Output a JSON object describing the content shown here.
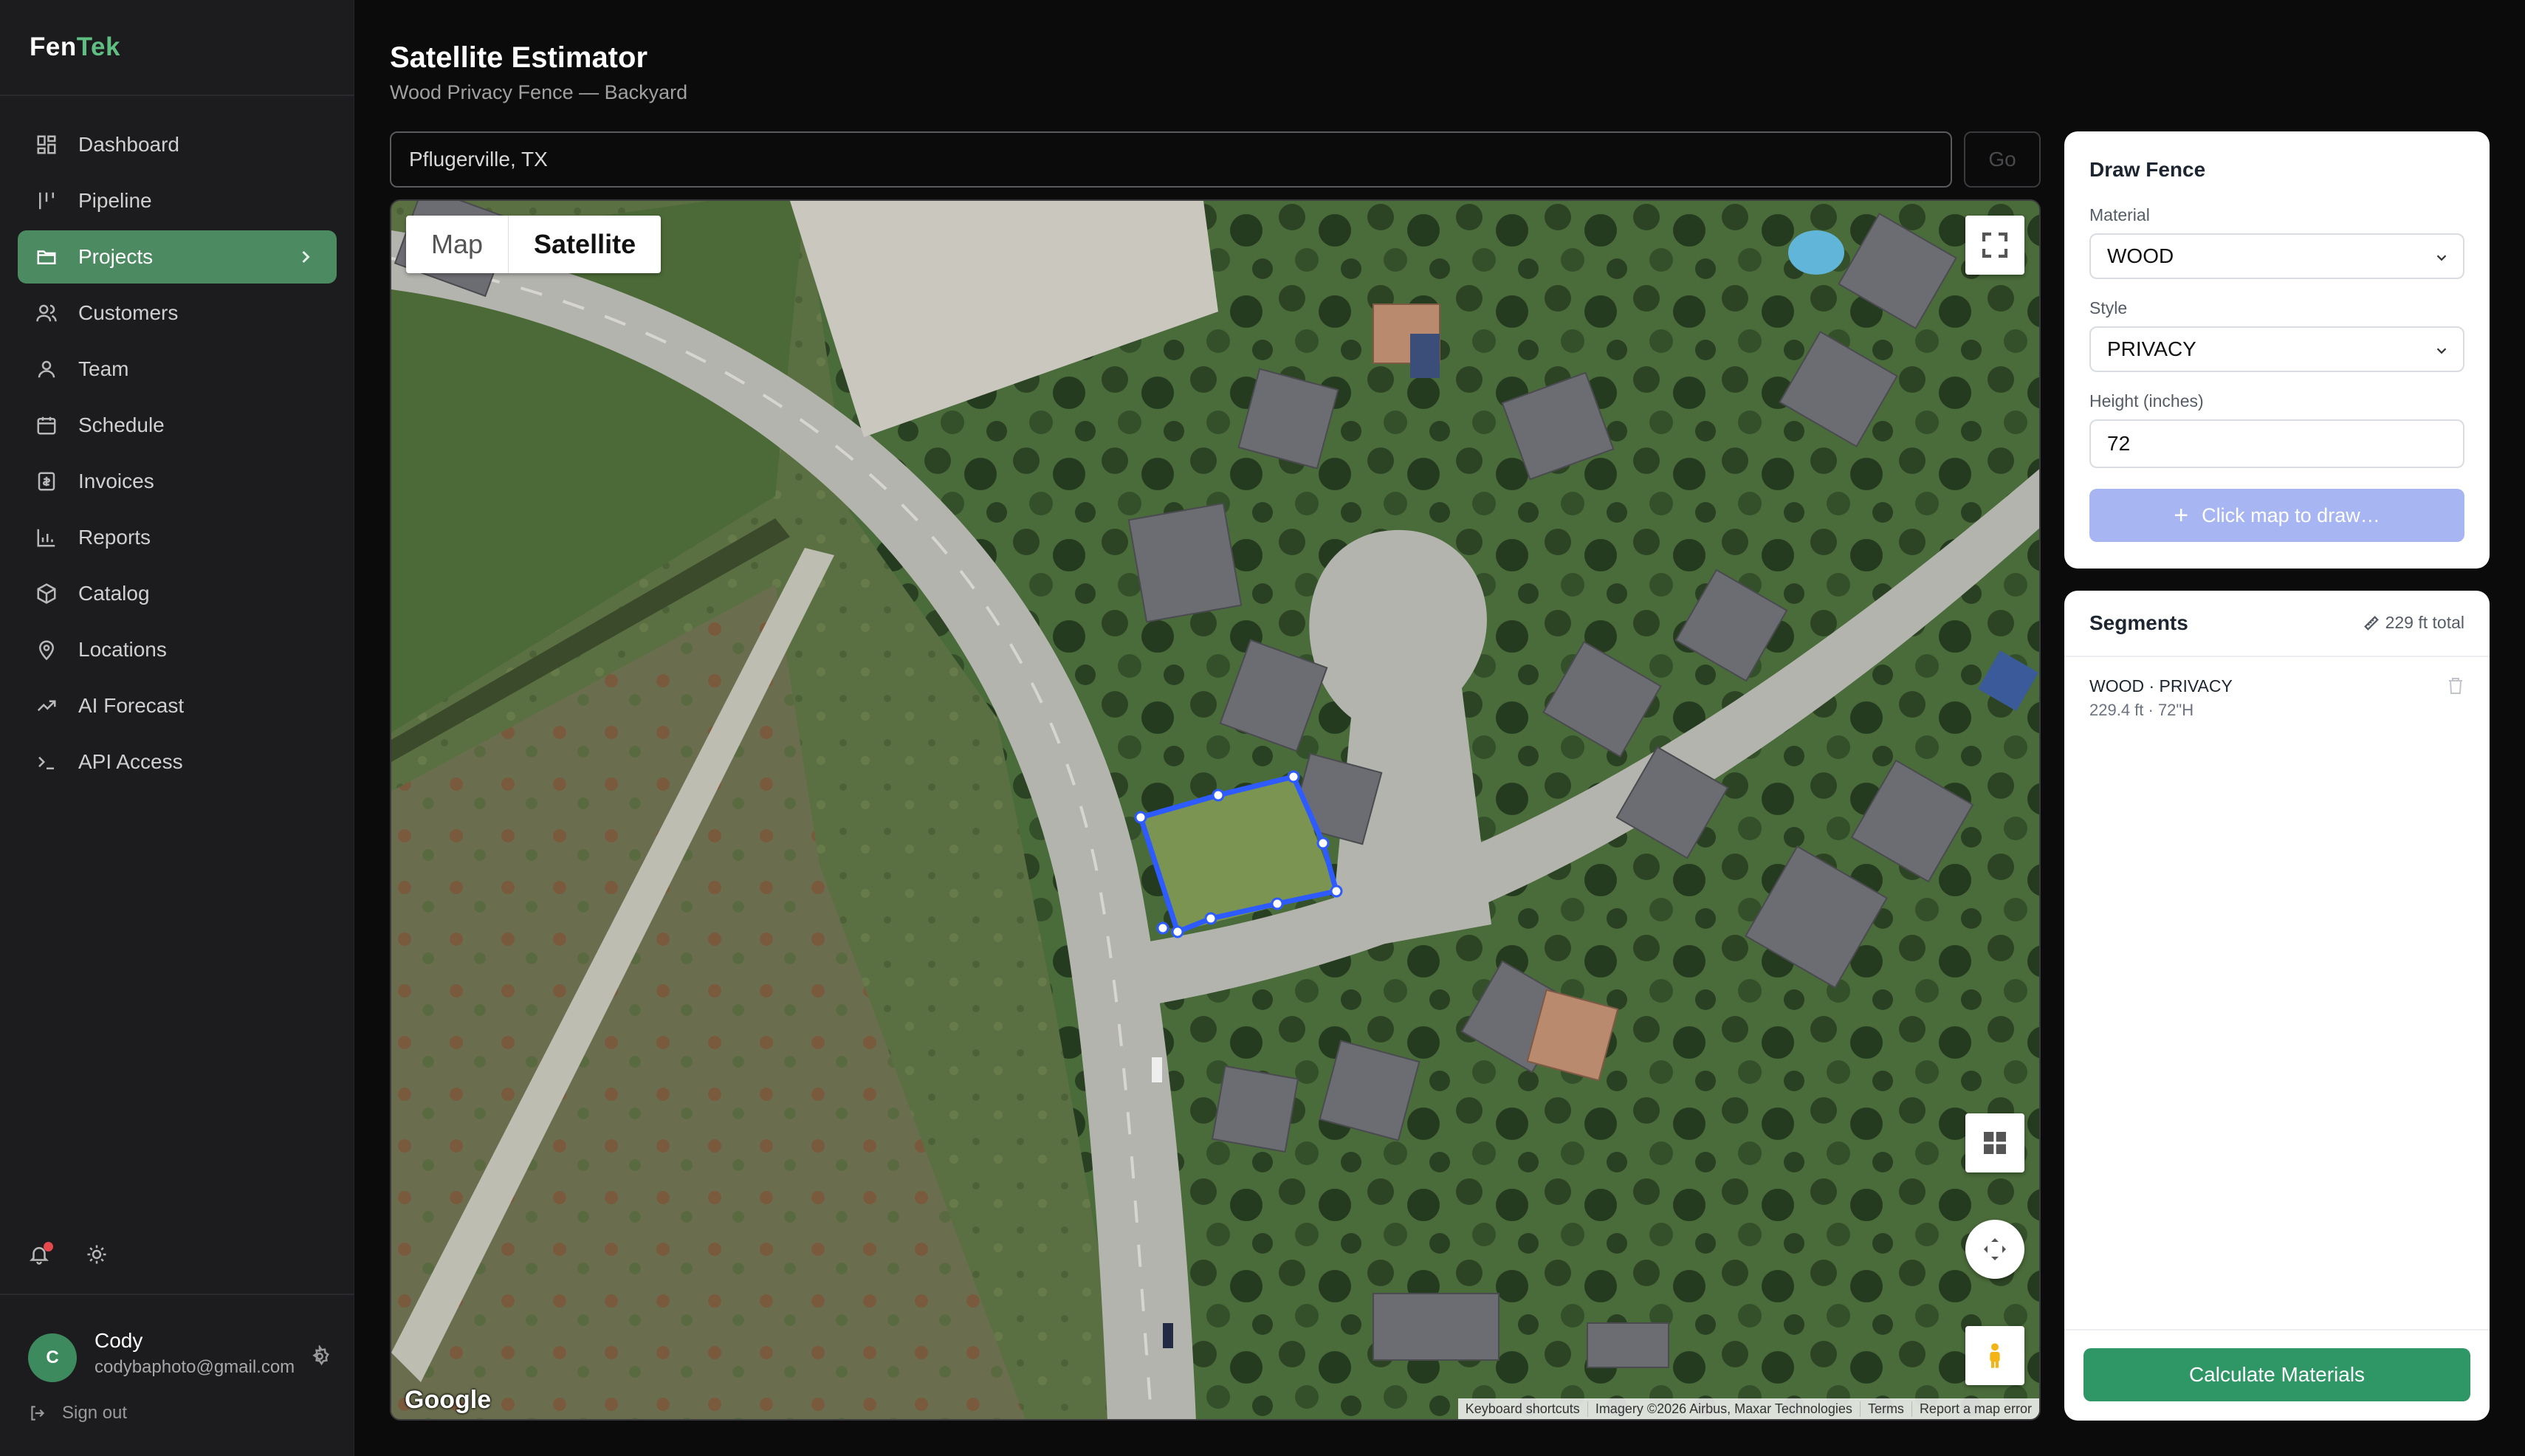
{
  "brand": {
    "part1": "Fen",
    "part2": "Tek"
  },
  "sidebar": {
    "items": [
      {
        "label": "Dashboard",
        "icon": "grid-icon"
      },
      {
        "label": "Pipeline",
        "icon": "pipeline-icon"
      },
      {
        "label": "Projects",
        "icon": "folder-icon",
        "active": true
      },
      {
        "label": "Customers",
        "icon": "users-icon"
      },
      {
        "label": "Team",
        "icon": "user-icon"
      },
      {
        "label": "Schedule",
        "icon": "calendar-icon"
      },
      {
        "label": "Invoices",
        "icon": "invoice-icon"
      },
      {
        "label": "Reports",
        "icon": "bar-chart-icon"
      },
      {
        "label": "Catalog",
        "icon": "box-icon"
      },
      {
        "label": "Locations",
        "icon": "pin-icon"
      },
      {
        "label": "AI Forecast",
        "icon": "trend-icon"
      },
      {
        "label": "API Access",
        "icon": "terminal-icon"
      }
    ]
  },
  "user": {
    "initial": "C",
    "name": "Cody",
    "email": "codybaphoto@gmail.com"
  },
  "signout_label": "Sign out",
  "header": {
    "title": "Satellite Estimator",
    "subtitle": "Wood Privacy Fence — Backyard"
  },
  "search": {
    "value": "Pflugerville, TX",
    "go_label": "Go"
  },
  "map": {
    "type_options": [
      "Map",
      "Satellite"
    ],
    "selected_type": "Satellite",
    "logo_text": "Google",
    "attribution": [
      "Keyboard shortcuts",
      "Imagery ©2026 Airbus, Maxar Technologies",
      "Terms",
      "Report a map error"
    ]
  },
  "draw_panel": {
    "title": "Draw Fence",
    "material_label": "Material",
    "material_value": "WOOD",
    "style_label": "Style",
    "style_value": "PRIVACY",
    "height_label": "Height (inches)",
    "height_value": "72",
    "draw_button": "Click map to draw…"
  },
  "segments_panel": {
    "title": "Segments",
    "total": "229 ft total",
    "segments": [
      {
        "title": "WOOD · PRIVACY",
        "meta": "229.4 ft · 72\"H"
      }
    ],
    "calculate_button": "Calculate Materials"
  },
  "colors": {
    "accent": "#4c8a61",
    "primary_button": "#2f9665",
    "draw_button": "#a7b6f3",
    "fence_line": "#2d5bff"
  }
}
